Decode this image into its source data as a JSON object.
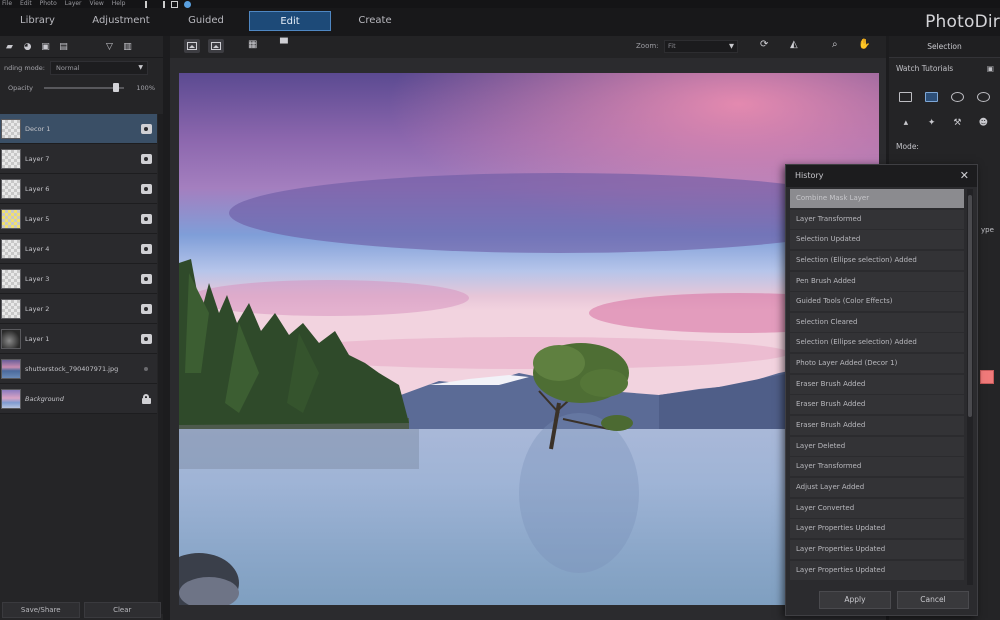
{
  "menubar": {
    "items": [
      "File",
      "Edit",
      "Photo",
      "Layer",
      "View",
      "Help"
    ]
  },
  "modes": [
    "Library",
    "Adjustment",
    "Guided",
    "Edit",
    "Create"
  ],
  "active_mode": "Edit",
  "brand": "PhotoDir",
  "left_panel": {
    "blending_label": "nding mode:",
    "blending_value": "Normal",
    "opacity_label": "Opacity",
    "opacity_value": "100%",
    "opacity_fraction": 0.9,
    "layers": [
      {
        "name": "Decor 1",
        "thumb": "checker",
        "selected": true
      },
      {
        "name": "Layer 7",
        "thumb": "checker"
      },
      {
        "name": "Layer 6",
        "thumb": "checker"
      },
      {
        "name": "Layer 5",
        "thumb": "yellow"
      },
      {
        "name": "Layer 4",
        "thumb": "checker"
      },
      {
        "name": "Layer 3",
        "thumb": "checker"
      },
      {
        "name": "Layer 2",
        "thumb": "checker"
      },
      {
        "name": "Layer 1",
        "thumb": "dark"
      },
      {
        "name": "shutterstock_790407971.jpg",
        "thumb": "photo1"
      },
      {
        "name": "Background",
        "thumb": "photo2",
        "italic": true,
        "locked": true
      }
    ],
    "save_share": "Save/Share",
    "clear": "Clear"
  },
  "canvas_toolbar": {
    "zoom_label": "Zoom:",
    "zoom_value": "Fit"
  },
  "right_panel": {
    "header": "Selection",
    "watch_tutorials": "Watch Tutorials",
    "mode_label": "Mode:",
    "cut_text_1": "ype"
  },
  "history": {
    "title": "History",
    "items": [
      "Combine Mask Layer",
      "Layer Transformed",
      "Selection Updated",
      "Selection (Ellipse selection) Added",
      "Pen Brush Added",
      "Guided Tools (Color Effects)",
      "Selection Cleared",
      "Selection (Ellipse selection) Added",
      "Photo Layer Added (Decor 1)",
      "Eraser Brush Added",
      "Eraser Brush Added",
      "Eraser Brush Added",
      "Layer Deleted",
      "Layer Transformed",
      "Adjust Layer Added",
      "Layer Converted",
      "Layer Properties Updated",
      "Layer Properties Updated",
      "Layer Properties Updated"
    ],
    "apply": "Apply",
    "cancel": "Cancel"
  },
  "colors": {
    "accent": "#1d4a78",
    "selected_layer": "#3a4f66",
    "swatch": "#f07a7a"
  }
}
